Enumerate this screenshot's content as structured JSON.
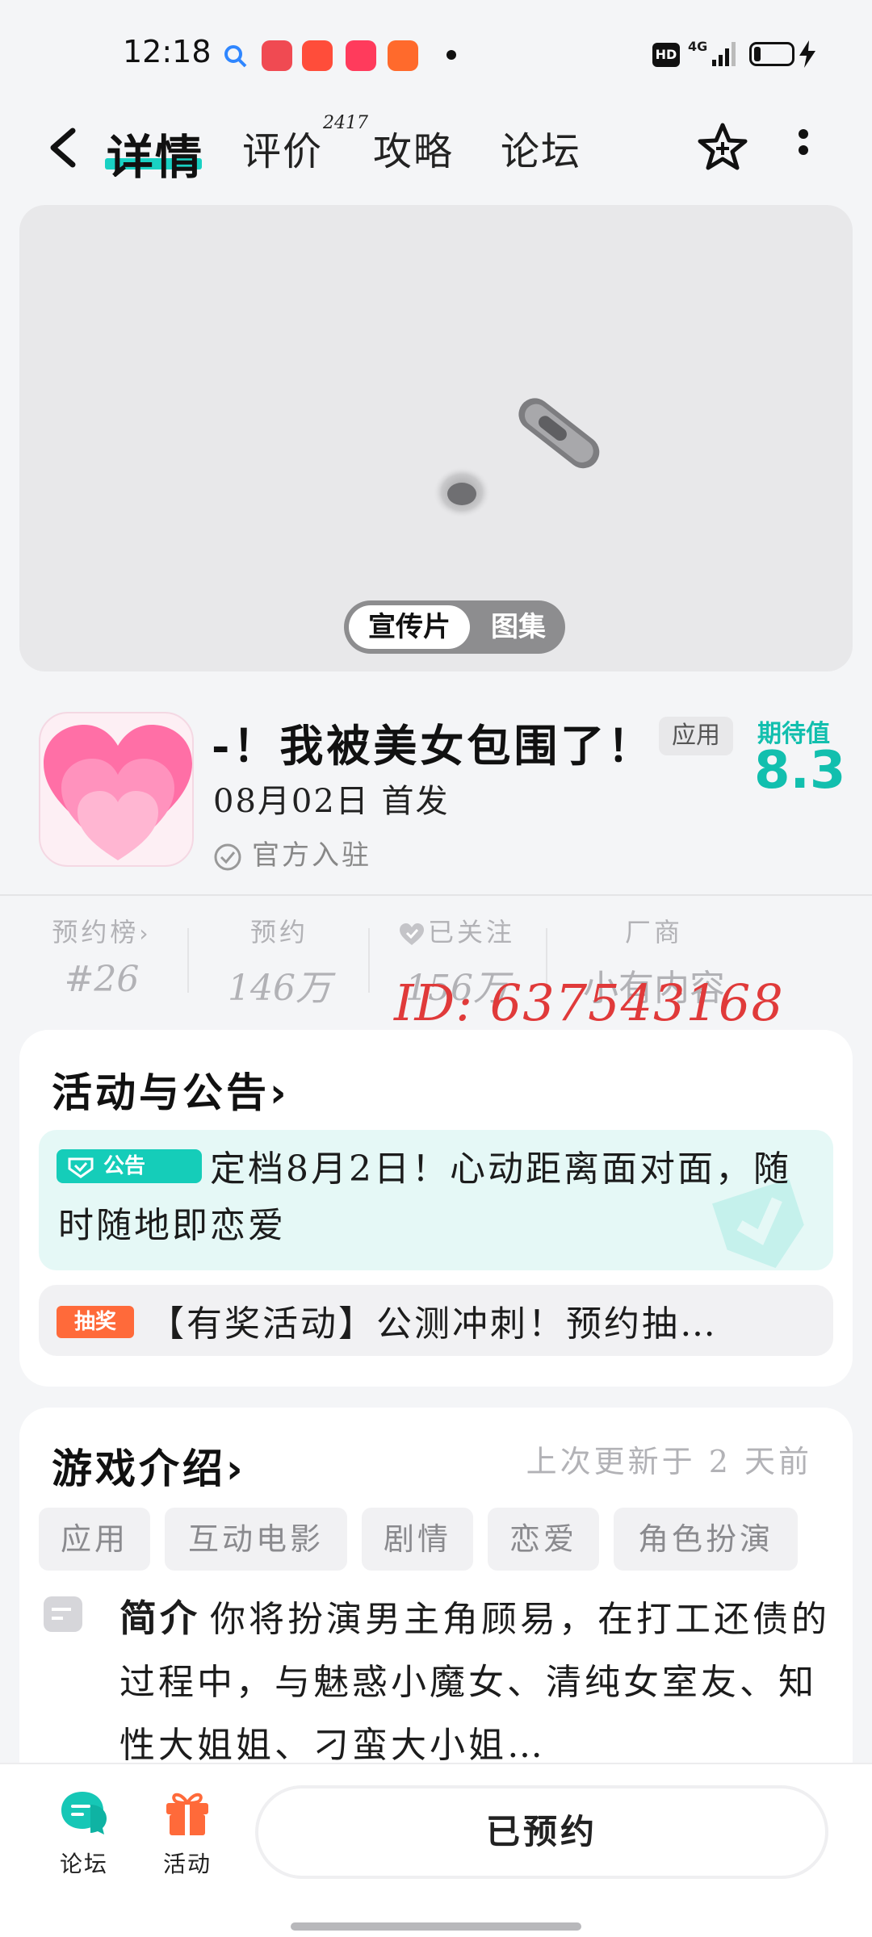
{
  "status_bar": {
    "time": "12:18",
    "hd": "HD",
    "network": "4G",
    "apps": [
      "search-app-icon",
      "douyin-app-icon",
      "character-app-icon",
      "video-app-icon",
      "store-app-icon"
    ]
  },
  "nav": {
    "tabs": [
      "详情",
      "评价",
      "攻略",
      "论坛"
    ],
    "review_count": "2417"
  },
  "media": {
    "tab_video": "宣传片",
    "tab_gallery": "图集"
  },
  "game": {
    "title": "-！我被美女包围了！",
    "type_badge": "应用",
    "release": "08月02日 首发",
    "official": "官方入驻",
    "expect_label": "期待值",
    "expect_value": "8.3"
  },
  "stats": [
    {
      "label": "预约榜",
      "value": "#26"
    },
    {
      "label": "预约",
      "value": "146万"
    },
    {
      "label": "已关注",
      "value": "156万"
    },
    {
      "label": "厂商",
      "value": "小有内容"
    }
  ],
  "watermark": "ID: 637543168",
  "activity": {
    "title": "活动与公告",
    "notice_badge": "公告",
    "notice_text": "定档8月2日！心动距离面对面，随时随地即恋爱",
    "lottery_badge": "抽奖",
    "lottery_text": "【有奖活动】公测冲刺！预约抽…"
  },
  "intro": {
    "title": "游戏介绍",
    "updated": "上次更新于 2 天前",
    "tags": [
      "应用",
      "互动电影",
      "剧情",
      "恋爱",
      "角色扮演"
    ],
    "desc_label": "简介",
    "desc_text": "你将扮演男主角顾易，在打工还债的过程中，与魅惑小魔女、清纯女室友、知性大姐姐、刁蛮大小姐…"
  },
  "bottom": {
    "forum": "论坛",
    "activity": "活动",
    "reserve": "已预约"
  },
  "colors": {
    "accent": "#19d1c3",
    "expect": "#12bfae",
    "lottery": "#ff6a3a",
    "watermark": "#e03a3a"
  }
}
